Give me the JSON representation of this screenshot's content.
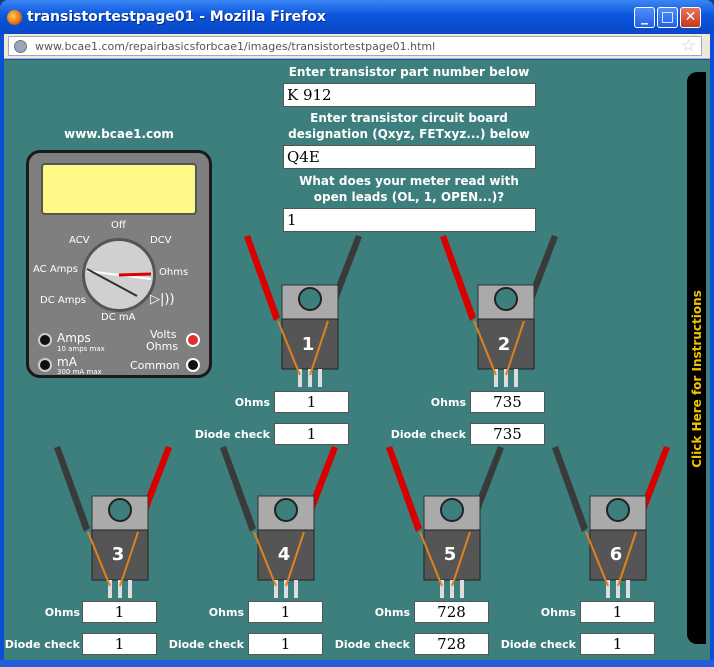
{
  "window": {
    "title": "transistortestpage01 - Mozilla Firefox"
  },
  "address": {
    "url": "www.bcae1.com/repairbasicsforbcae1/images/transistortestpage01.html"
  },
  "page": {
    "site": "www.bcae1.com",
    "part_label": "Enter transistor part number below",
    "part_value": "K 912",
    "designation_label_1": "Enter transistor circuit board",
    "designation_label_2": "designation (Qxyz, FETxyz...) below",
    "designation_value": "Q4E",
    "open_label_1": "What does your meter read with",
    "open_label_2": "open leads (OL, 1, OPEN...)?",
    "open_value": "1",
    "sidebar_text": "Click Here for Instructions"
  },
  "meter": {
    "off": "Off",
    "acv": "ACV",
    "dcv": "DCV",
    "ac_amps": "AC Amps",
    "ohms": "Ohms",
    "dc_amps": "DC Amps",
    "dc_ma": "DC mA",
    "amps": "Amps",
    "amps_max": "10 amps max",
    "ma": "mA",
    "ma_max": "300 mA max",
    "volts": "Volts",
    "ohms2": "Ohms",
    "common": "Common"
  },
  "labels": {
    "ohms": "Ohms",
    "diode": "Diode check"
  },
  "transistors": [
    {
      "num": "1",
      "ohms": "1",
      "diode": "1"
    },
    {
      "num": "2",
      "ohms": "735",
      "diode": "735"
    },
    {
      "num": "3",
      "ohms": "1",
      "diode": "1"
    },
    {
      "num": "4",
      "ohms": "1",
      "diode": "1"
    },
    {
      "num": "5",
      "ohms": "728",
      "diode": "728"
    },
    {
      "num": "6",
      "ohms": "1",
      "diode": "1"
    }
  ],
  "colors": {
    "page_bg": "#3d7f7d",
    "probe_red": "#d90000",
    "probe_black": "#3a3a3a",
    "sidebar_text": "#f2c400"
  }
}
